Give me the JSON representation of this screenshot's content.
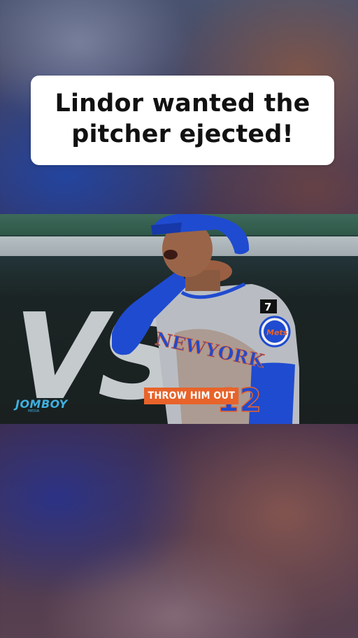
{
  "caption": {
    "line1": "Lindor wanted the",
    "line2": "pitcher ejected!"
  },
  "video": {
    "subtitle": "THROW HIM OUT",
    "watermark": "JOMBOY",
    "watermark_sub": "MEDIA",
    "jersey_text": "NEWYORK",
    "jersey_number": "12",
    "sleeve_number": "7",
    "background_sign": "VS"
  },
  "colors": {
    "caption_bg": "#ffffff",
    "caption_text": "#111111",
    "subtitle_bg": "#e8632a",
    "watermark": "#3fb0e0",
    "mets_blue": "#1f4bd0",
    "mets_orange": "#e8632a"
  }
}
